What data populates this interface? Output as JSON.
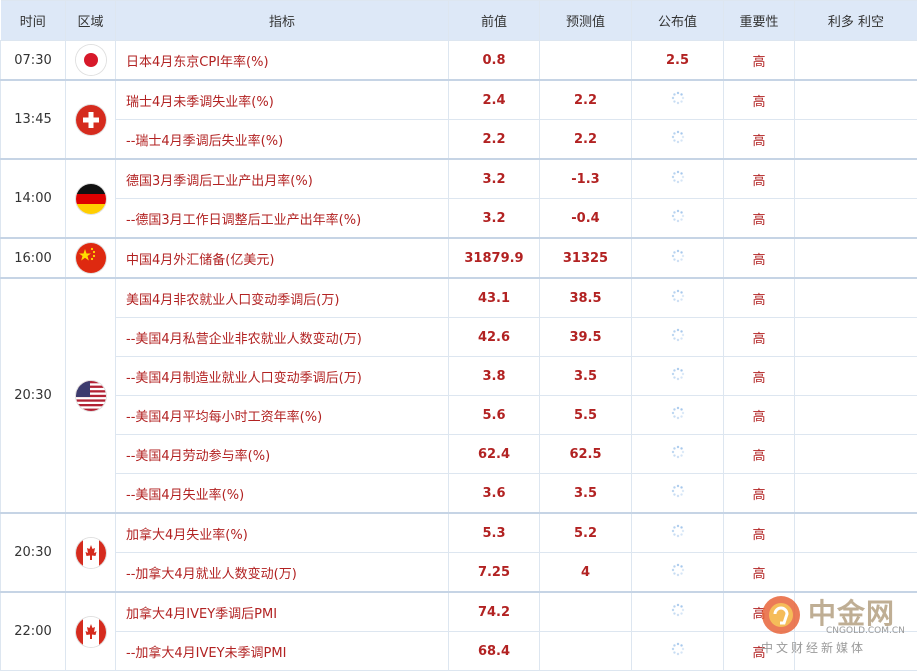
{
  "headers": {
    "time": "时间",
    "region": "区域",
    "indicator": "指标",
    "previous": "前值",
    "forecast": "预测值",
    "actual": "公布值",
    "importance": "重要性",
    "impact": "利多 利空"
  },
  "groups": [
    {
      "time": "07:30",
      "flag": "japan-flag-icon",
      "rows": [
        {
          "indicator": "日本4月东京CPI年率(%)",
          "previous": "0.8",
          "forecast": "",
          "actual": "2.5",
          "importance": "高"
        }
      ]
    },
    {
      "time": "13:45",
      "flag": "switzerland-flag-icon",
      "rows": [
        {
          "indicator": "瑞士4月未季调失业率(%)",
          "previous": "2.4",
          "forecast": "2.2",
          "actual": "",
          "importance": "高"
        },
        {
          "indicator": "--瑞士4月季调后失业率(%)",
          "previous": "2.2",
          "forecast": "2.2",
          "actual": "",
          "importance": "高"
        }
      ]
    },
    {
      "time": "14:00",
      "flag": "germany-flag-icon",
      "rows": [
        {
          "indicator": "德国3月季调后工业产出月率(%)",
          "previous": "3.2",
          "forecast": "-1.3",
          "actual": "",
          "importance": "高"
        },
        {
          "indicator": "--德国3月工作日调整后工业产出年率(%)",
          "previous": "3.2",
          "forecast": "-0.4",
          "actual": "",
          "importance": "高"
        }
      ]
    },
    {
      "time": "16:00",
      "flag": "china-flag-icon",
      "rows": [
        {
          "indicator": "中国4月外汇储备(亿美元)",
          "previous": "31879.9",
          "forecast": "31325",
          "actual": "",
          "importance": "高"
        }
      ]
    },
    {
      "time": "20:30",
      "flag": "usa-flag-icon",
      "rows": [
        {
          "indicator": "美国4月非农就业人口变动季调后(万)",
          "previous": "43.1",
          "forecast": "38.5",
          "actual": "",
          "importance": "高"
        },
        {
          "indicator": "--美国4月私营企业非农就业人数变动(万)",
          "previous": "42.6",
          "forecast": "39.5",
          "actual": "",
          "importance": "高"
        },
        {
          "indicator": "--美国4月制造业就业人口变动季调后(万)",
          "previous": "3.8",
          "forecast": "3.5",
          "actual": "",
          "importance": "高"
        },
        {
          "indicator": "--美国4月平均每小时工资年率(%)",
          "previous": "5.6",
          "forecast": "5.5",
          "actual": "",
          "importance": "高"
        },
        {
          "indicator": "--美国4月劳动参与率(%)",
          "previous": "62.4",
          "forecast": "62.5",
          "actual": "",
          "importance": "高"
        },
        {
          "indicator": "--美国4月失业率(%)",
          "previous": "3.6",
          "forecast": "3.5",
          "actual": "",
          "importance": "高"
        }
      ]
    },
    {
      "time": "20:30",
      "flag": "canada-flag-icon",
      "rows": [
        {
          "indicator": "加拿大4月失业率(%)",
          "previous": "5.3",
          "forecast": "5.2",
          "actual": "",
          "importance": "高"
        },
        {
          "indicator": "--加拿大4月就业人数变动(万)",
          "previous": "7.25",
          "forecast": "4",
          "actual": "",
          "importance": "高"
        }
      ]
    },
    {
      "time": "22:00",
      "flag": "canada-flag-icon",
      "rows": [
        {
          "indicator": "加拿大4月IVEY季调后PMI",
          "previous": "74.2",
          "forecast": "",
          "actual": "",
          "importance": "高"
        },
        {
          "indicator": "--加拿大4月IVEY未季调PMI",
          "previous": "68.4",
          "forecast": "",
          "actual": "",
          "importance": "高"
        }
      ]
    }
  ],
  "watermark": {
    "name": "中金网",
    "site": "CNGOLD.COM.CN",
    "sub": "中文财经新媒体"
  },
  "colors": {
    "accent": "#b22222",
    "header_bg": "#dde8f7",
    "border": "#dde6f0"
  }
}
